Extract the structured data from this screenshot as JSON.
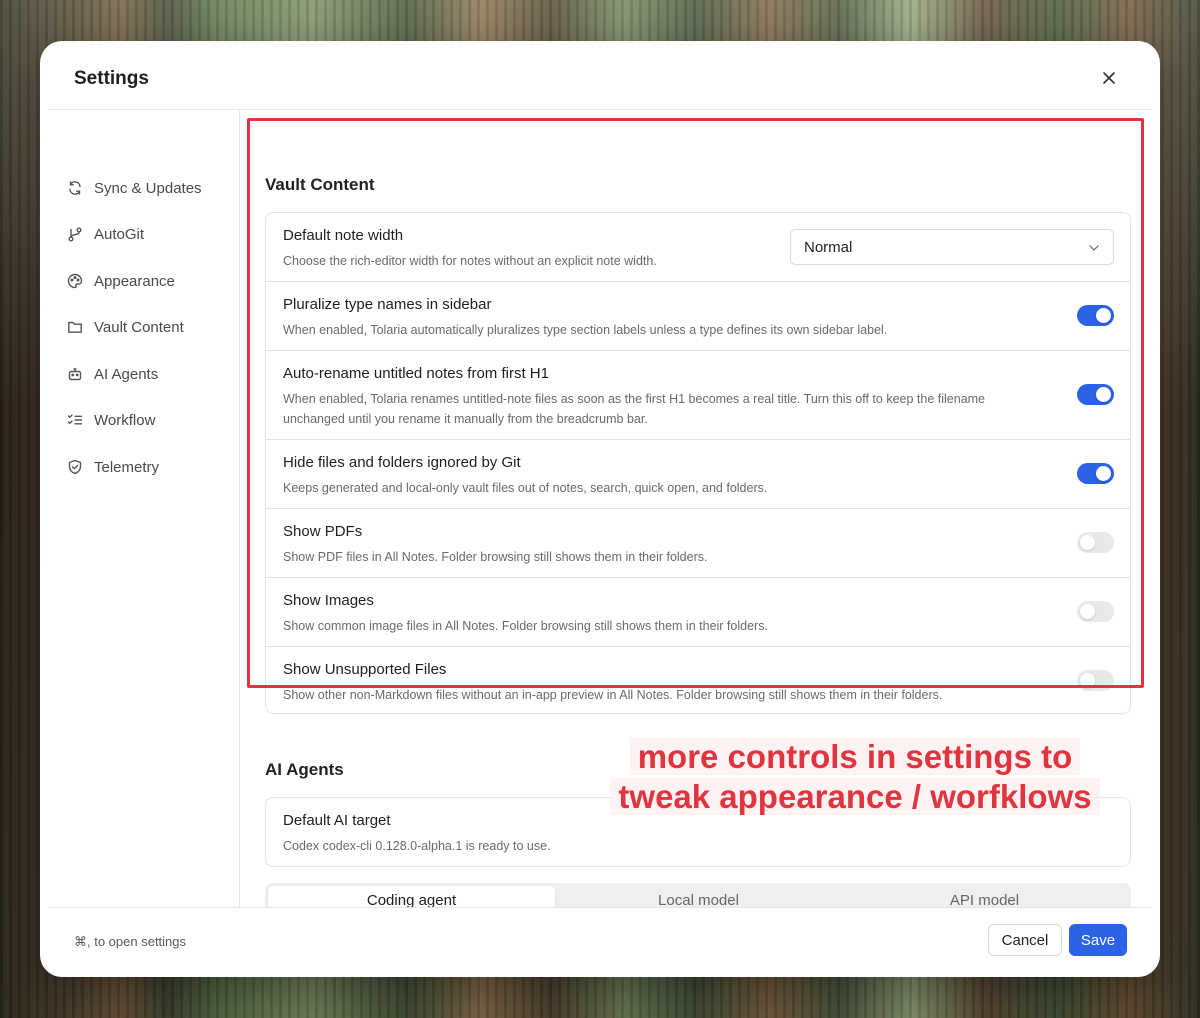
{
  "dialog": {
    "title": "Settings"
  },
  "sidebar": {
    "items": [
      {
        "label": "Sync & Updates",
        "icon": "sync-icon"
      },
      {
        "label": "AutoGit",
        "icon": "git-branch-icon"
      },
      {
        "label": "Appearance",
        "icon": "palette-icon"
      },
      {
        "label": "Vault Content",
        "icon": "folder-icon"
      },
      {
        "label": "AI Agents",
        "icon": "robot-icon"
      },
      {
        "label": "Workflow",
        "icon": "checklist-icon"
      },
      {
        "label": "Telemetry",
        "icon": "shield-icon"
      }
    ]
  },
  "vault_content": {
    "title": "Vault Content",
    "note_width": {
      "title": "Default note width",
      "desc": "Choose the rich-editor width for notes without an explicit note width.",
      "value": "Normal"
    },
    "rows": [
      {
        "title": "Pluralize type names in sidebar",
        "desc": "When enabled, Tolaria automatically pluralizes type section labels unless a type defines its own sidebar label.",
        "enabled": true
      },
      {
        "title": "Auto-rename untitled notes from first H1",
        "desc": "When enabled, Tolaria renames untitled-note files as soon as the first H1 becomes a real title. Turn this off to keep the filename unchanged until you rename it manually from the breadcrumb bar.",
        "enabled": true
      },
      {
        "title": "Hide files and folders ignored by Git",
        "desc": "Keeps generated and local-only vault files out of notes, search, quick open, and folders.",
        "enabled": true
      },
      {
        "title": "Show PDFs",
        "desc": "Show PDF files in All Notes. Folder browsing still shows them in their folders.",
        "enabled": false
      },
      {
        "title": "Show Images",
        "desc": "Show common image files in All Notes. Folder browsing still shows them in their folders.",
        "enabled": false
      },
      {
        "title": "Show Unsupported Files",
        "desc": "Show other non-Markdown files without an in-app preview in All Notes. Folder browsing still shows them in their folders.",
        "enabled": false
      }
    ]
  },
  "ai_agents": {
    "title": "AI Agents",
    "default_target": {
      "title": "Default AI target",
      "desc": "Codex codex-cli 0.128.0-alpha.1 is ready to use."
    },
    "tabs": [
      "Coding agent",
      "Local model",
      "API model"
    ],
    "active_tab": "Coding agent"
  },
  "annotation": {
    "line1": "more controls in settings to",
    "line2": "tweak appearance / worfklows",
    "color": "#e0343f"
  },
  "footer": {
    "hint": "⌘, to open settings",
    "cancel_label": "Cancel",
    "save_label": "Save"
  },
  "colors": {
    "accent": "#2b62e6",
    "highlight": "#e0343f"
  }
}
